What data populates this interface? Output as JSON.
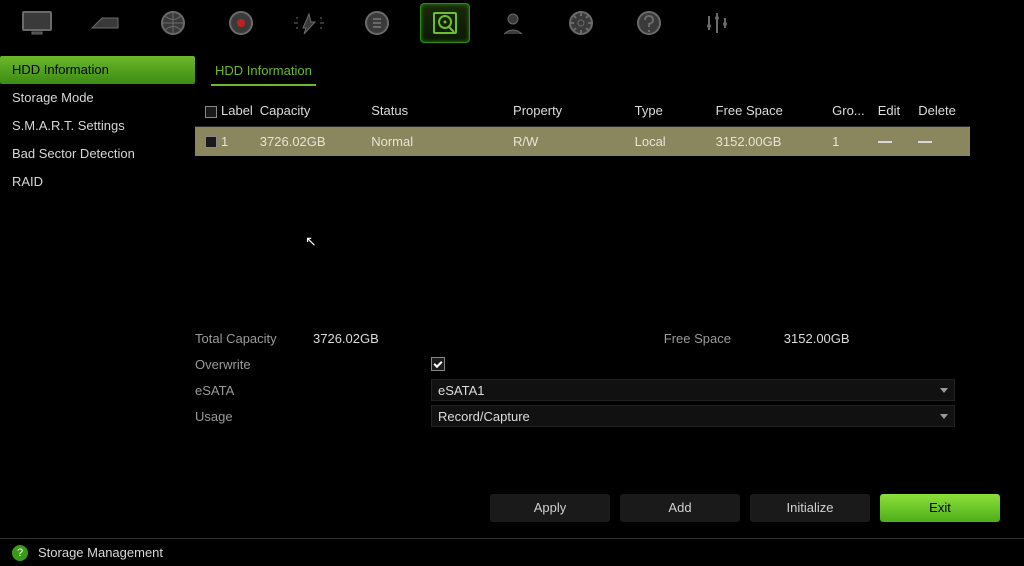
{
  "topicons": [
    "monitor-icon",
    "device-icon",
    "network-icon",
    "record-icon",
    "motion-icon",
    "sensor-icon",
    "hdd-icon",
    "user-icon",
    "system-icon",
    "info-icon",
    "equalizer-icon"
  ],
  "sidebar": {
    "items": [
      {
        "label": "HDD Information"
      },
      {
        "label": "Storage Mode"
      },
      {
        "label": "S.M.A.R.T. Settings"
      },
      {
        "label": "Bad Sector Detection"
      },
      {
        "label": "RAID"
      }
    ]
  },
  "tab_title": "HDD Information",
  "table": {
    "headers": {
      "label": "Label",
      "capacity": "Capacity",
      "status": "Status",
      "property": "Property",
      "type": "Type",
      "free": "Free Space",
      "group": "Gro...",
      "edit": "Edit",
      "delete": "Delete"
    },
    "rows": [
      {
        "label": "1",
        "capacity": "3726.02GB",
        "status": "Normal",
        "property": "R/W",
        "type": "Local",
        "free": "3152.00GB",
        "group": "1"
      }
    ]
  },
  "summary": {
    "total_capacity_label": "Total Capacity",
    "total_capacity": "3726.02GB",
    "free_space_label": "Free Space",
    "free_space": "3152.00GB",
    "overwrite_label": "Overwrite",
    "overwrite_checked": true,
    "esata_label": "eSATA",
    "esata_value": "eSATA1",
    "usage_label": "Usage",
    "usage_value": "Record/Capture"
  },
  "buttons": {
    "apply": "Apply",
    "add": "Add",
    "initialize": "Initialize",
    "exit": "Exit"
  },
  "status_bar": "Storage Management"
}
